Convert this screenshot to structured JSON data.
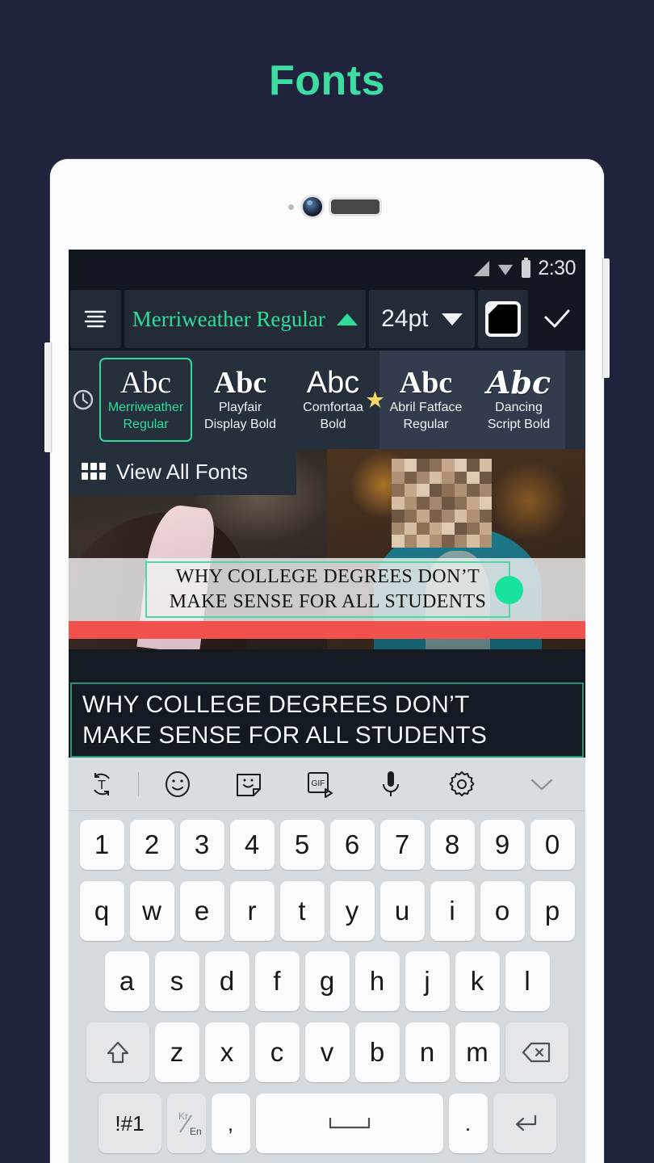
{
  "page": {
    "title": "Fonts",
    "accent": "#3ddca2",
    "background": "#20233c"
  },
  "status_bar": {
    "time": "2:30",
    "signal_icon": "signal-icon",
    "wifi_icon": "wifi-icon",
    "battery_icon": "battery-icon"
  },
  "editor_toolbar": {
    "align_icon": "text-align-icon",
    "font_name": "Merriweather Regular",
    "font_caret_icon": "caret-up-icon",
    "font_size": "24pt",
    "size_caret_icon": "caret-down-icon",
    "color_swatch": "color-swatch-black",
    "confirm_icon": "checkmark-icon"
  },
  "font_picker": {
    "recent_icon": "clock-icon",
    "fonts": [
      {
        "sample": "Abc",
        "name_line1": "Merriweather",
        "name_line2": "Regular",
        "selected": true,
        "favorite": false
      },
      {
        "sample": "Abc",
        "name_line1": "Playfair",
        "name_line2": "Display Bold",
        "selected": false,
        "favorite": false
      },
      {
        "sample": "Abc",
        "name_line1": "Comfortaa",
        "name_line2": "Bold",
        "selected": false,
        "favorite": false
      },
      {
        "sample": "Abc",
        "name_line1": "Abril Fatface",
        "name_line2": "Regular",
        "selected": false,
        "favorite": true
      },
      {
        "sample": "Abc",
        "name_line1": "Dancing",
        "name_line2": "Script Bold",
        "selected": false,
        "favorite": false
      }
    ],
    "view_all": {
      "label": "View All Fonts",
      "icon": "grid-icon"
    }
  },
  "canvas": {
    "overlay_line1": "WHY COLLEGE DEGREES DON’T",
    "overlay_line2": "MAKE SENSE FOR ALL STUDENTS",
    "selection_color": "#4fd8a6",
    "handle_color": "#18e39b",
    "accent_bar_color": "#f2524e"
  },
  "caption": {
    "line1": "WHY COLLEGE DEGREES DON’T",
    "line2": "MAKE SENSE FOR ALL STUDENTS"
  },
  "keyboard": {
    "toolbar_icons": [
      "text-rotate-icon",
      "emoji-icon",
      "sticker-icon",
      "gif-icon",
      "microphone-icon",
      "settings-icon",
      "chevron-down-icon"
    ],
    "row_numbers": [
      "1",
      "2",
      "3",
      "4",
      "5",
      "6",
      "7",
      "8",
      "9",
      "0"
    ],
    "row_top": [
      "q",
      "w",
      "e",
      "r",
      "t",
      "y",
      "u",
      "i",
      "o",
      "p"
    ],
    "row_home": [
      "a",
      "s",
      "d",
      "f",
      "g",
      "h",
      "j",
      "k",
      "l"
    ],
    "row_bottom": [
      "z",
      "x",
      "c",
      "v",
      "b",
      "n",
      "m"
    ],
    "shift_icon": "shift-icon",
    "backspace_icon": "backspace-icon",
    "symbols_label": "!#1",
    "lang_label_top": "Kr",
    "lang_label_bottom": "En",
    "comma_label": ",",
    "space_icon": "space-icon",
    "period_label": ".",
    "enter_icon": "enter-icon"
  }
}
